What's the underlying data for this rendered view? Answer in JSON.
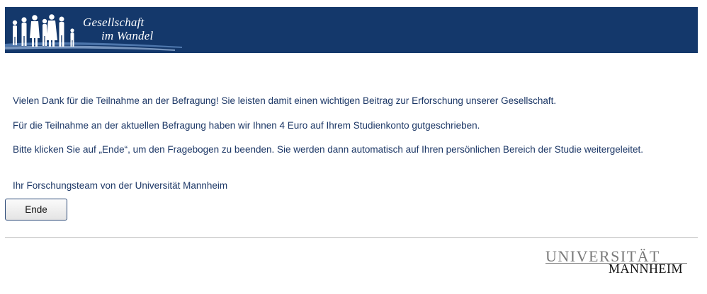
{
  "header": {
    "title_line1": "Gesellschaft",
    "title_line2": "im Wandel",
    "brand_color": "#14386b",
    "logo_icon": "people-silhouettes-icon"
  },
  "message": {
    "thanks": "Vielen Dank für die Teilnahme an der Befragung! Sie leisten damit einen wichtigen Beitrag zur Erforschung unserer Gesellschaft.",
    "credit": "Für die Teilnahme an der aktuellen Befragung haben wir Ihnen 4 Euro auf Ihrem Studienkonto gutgeschrieben.",
    "instruction": "Bitte klicken Sie auf „Ende“, um den Fragebogen zu beenden. Sie werden dann automatisch auf Ihren persönlichen Bereich der Studie weitergeleitet.",
    "signature": "Ihr Forschungsteam von der Universität Mannheim"
  },
  "actions": {
    "end_label": "Ende"
  },
  "footer": {
    "logo_line1": "UNIVERSITÄT",
    "logo_line2": "MANNHEIM"
  }
}
